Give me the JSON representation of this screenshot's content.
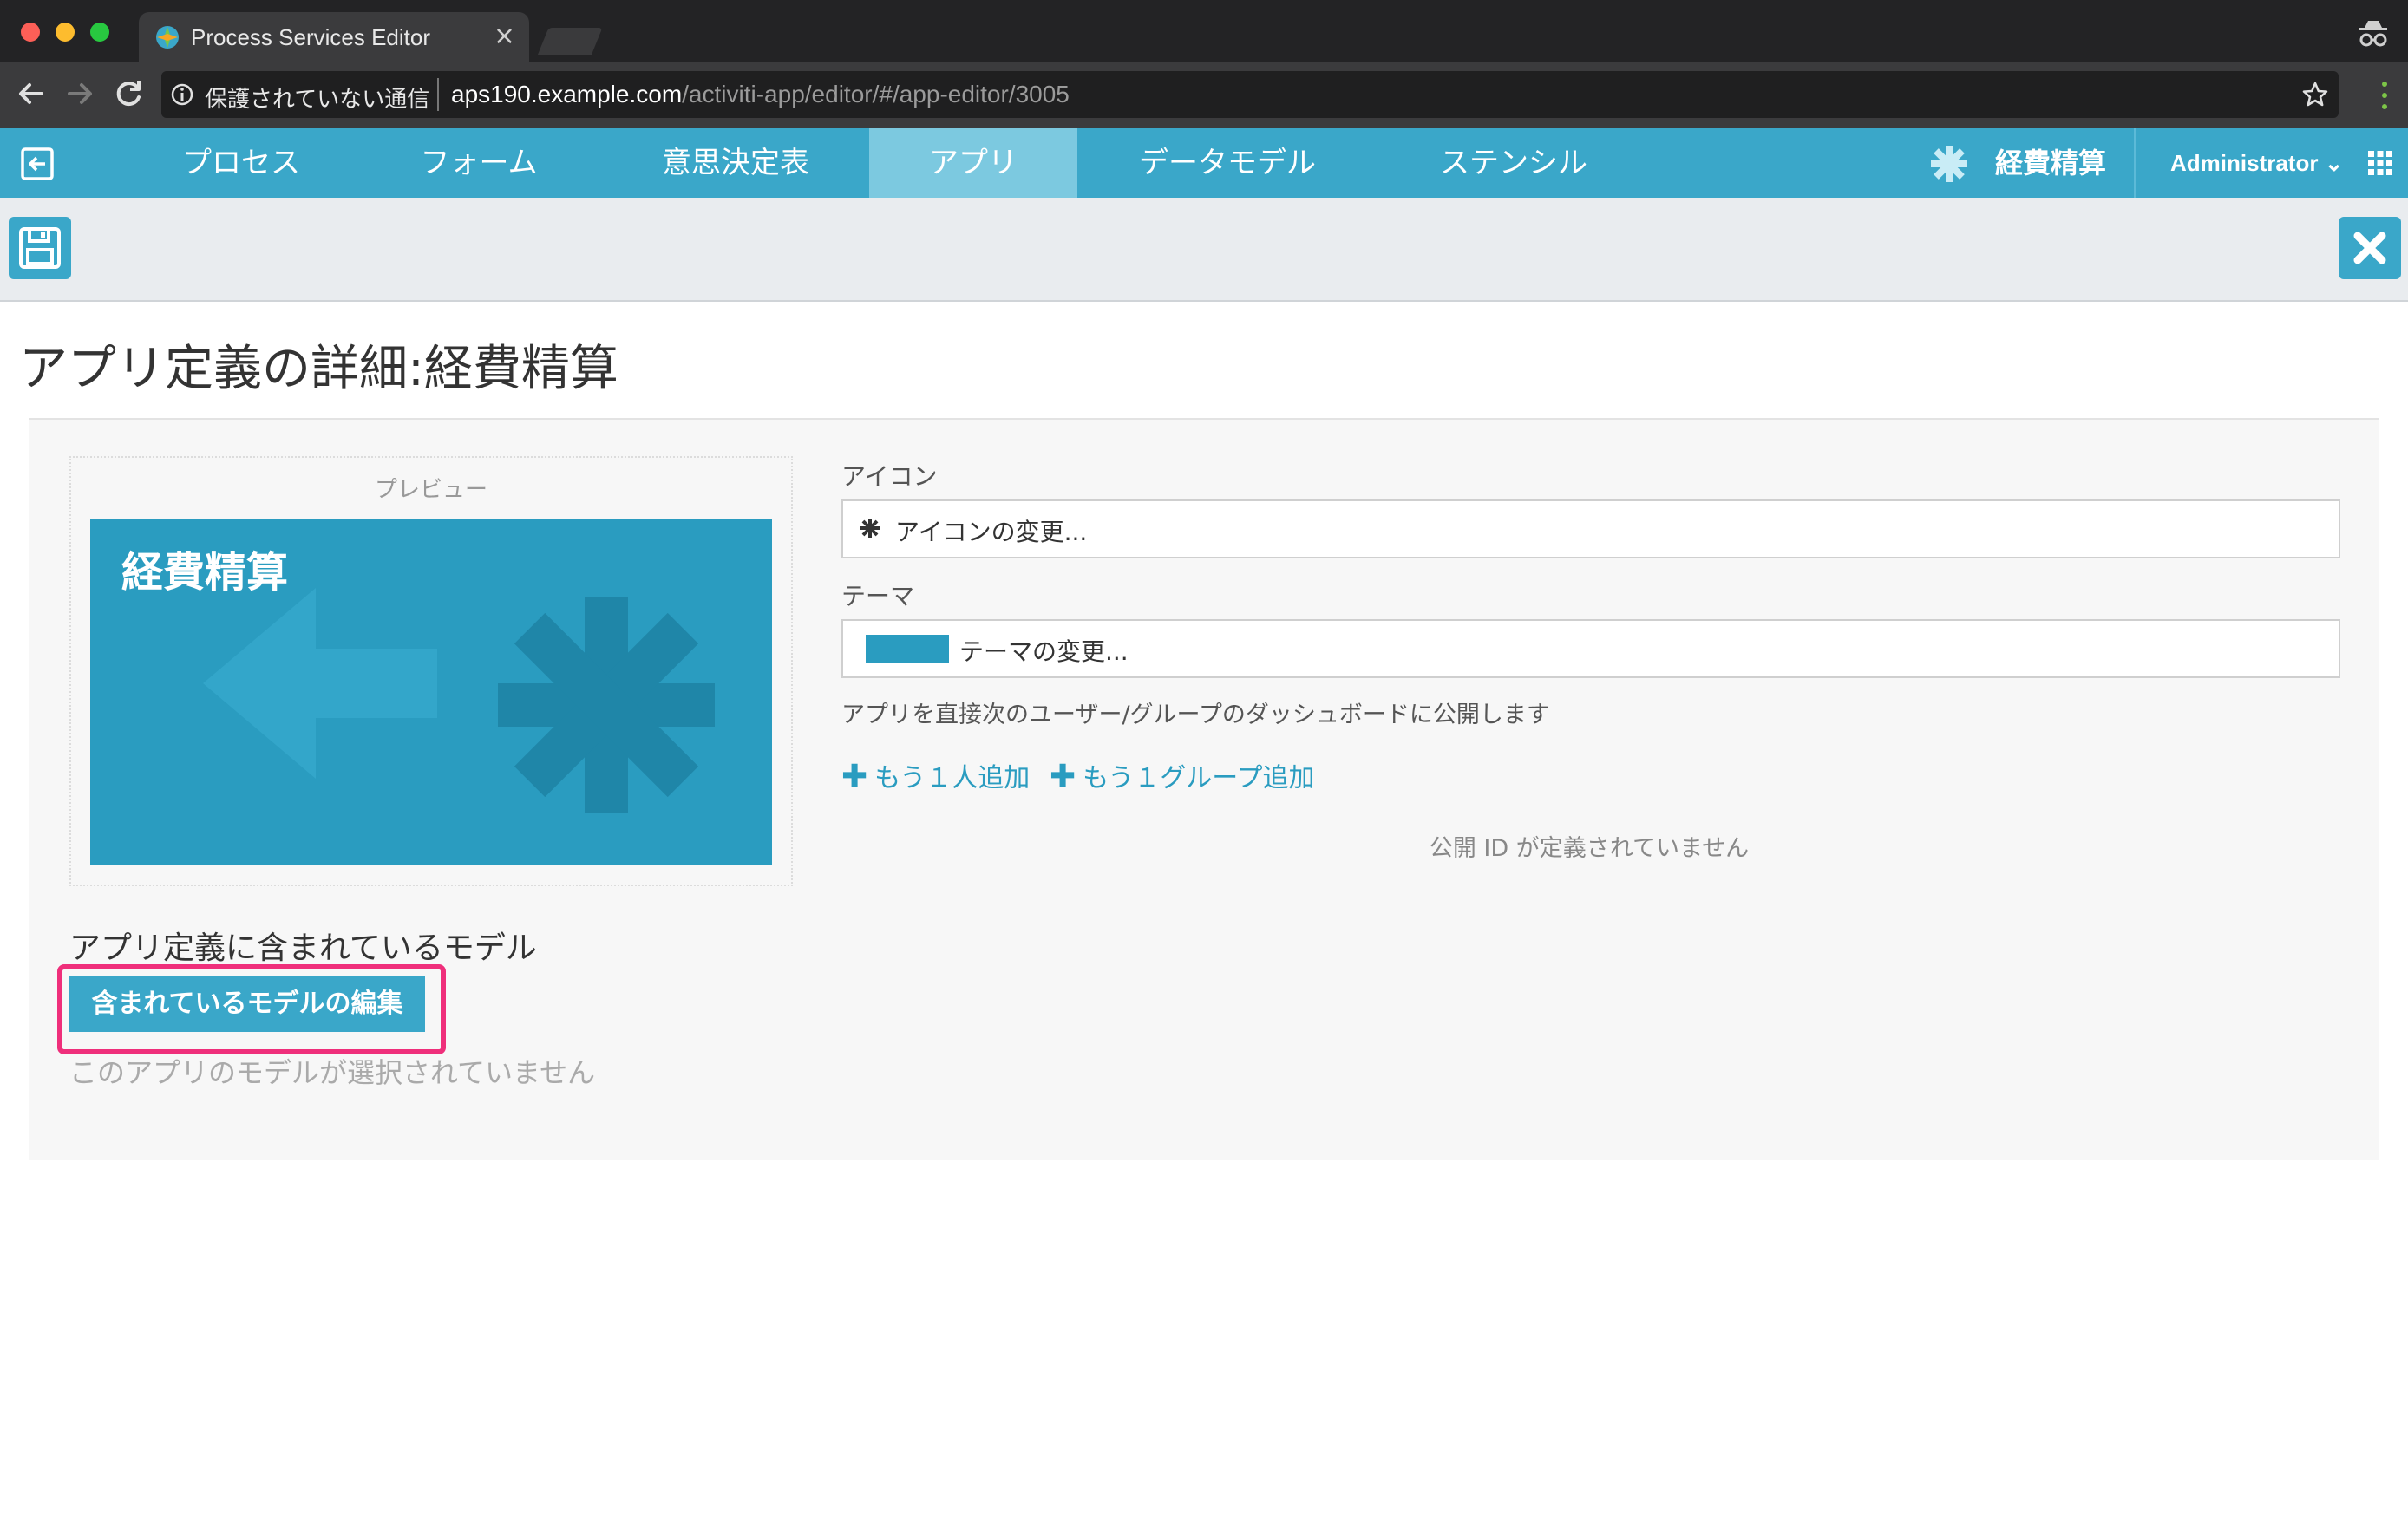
{
  "browser": {
    "tab_title": "Process Services Editor",
    "tab_close": "×",
    "url_insecure_label": "保護されていない通信",
    "url_host": "aps190.example.com",
    "url_path": "/activiti-app/editor/#/app-editor/3005"
  },
  "nav": {
    "tabs": [
      {
        "label": "プロセス"
      },
      {
        "label": "フォーム"
      },
      {
        "label": "意思決定表"
      },
      {
        "label": "アプリ"
      },
      {
        "label": "データモデル"
      },
      {
        "label": "ステンシル"
      }
    ],
    "active_tab": "アプリ",
    "app_name": "経費精算",
    "user": "Administrator",
    "user_caret": "⌄"
  },
  "page": {
    "title": "アプリ定義の詳細:経費精算"
  },
  "preview": {
    "label": "プレビュー",
    "tile_title": "経費精算",
    "tile_color": "#2a9cc0"
  },
  "form": {
    "icon_label": "アイコン",
    "icon_value": "アイコンの変更...",
    "theme_label": "テーマ",
    "theme_value": "テーマの変更...",
    "publish_text": "アプリを直接次のユーザー/グループのダッシュボードに公開します",
    "add_user_link": "もう１人追加",
    "add_group_link": "もう１グループ追加",
    "plus": "✚",
    "no_public_id": "公開 ID が定義されていません"
  },
  "models": {
    "heading": "アプリ定義に含まれているモデル",
    "edit_button": "含まれているモデルの編集",
    "empty_text": "このアプリのモデルが選択されていません"
  },
  "colors": {
    "accent": "#3aa7c9",
    "highlight": "#ef2f7b"
  }
}
